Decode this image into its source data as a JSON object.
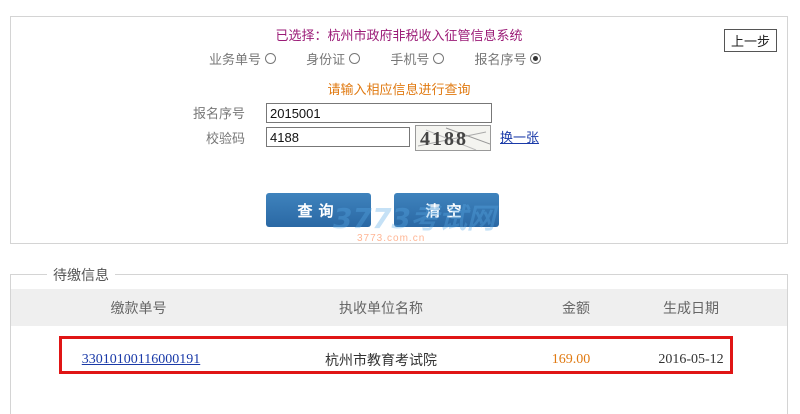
{
  "query_panel": {
    "selected_label": "已选择：杭州市政府非税收入征管信息系统",
    "back_button": "上一步",
    "options": [
      {
        "label": "业务单号",
        "checked": false
      },
      {
        "label": "身份证",
        "checked": false
      },
      {
        "label": "手机号",
        "checked": false
      },
      {
        "label": "报名序号",
        "checked": true
      }
    ],
    "hint": "请输入相应信息进行查询",
    "reg_no_label": "报名序号",
    "reg_no_value": "2015001",
    "captcha_label": "校验码",
    "captcha_value": "4188",
    "captcha_image_text": "4188",
    "refresh_link": "换一张",
    "query_button": "查询",
    "clear_button": "清空"
  },
  "watermark": {
    "main": "3773考试网",
    "sub": "3773.com.cn"
  },
  "pending": {
    "legend": "待缴信息",
    "columns": [
      "缴款单号",
      "执收单位名称",
      "金额",
      "生成日期"
    ],
    "rows": [
      {
        "order_no": "33010100116000191",
        "unit": "杭州市教育考试院",
        "amount": "169.00",
        "date": "2016-05-12"
      }
    ]
  },
  "colors": {
    "accent_purple": "#9b1b77",
    "hint_orange": "#e07a12",
    "button_blue": "#2a68a4",
    "highlight_red": "#e01515",
    "link_blue": "#1a3aa8"
  }
}
